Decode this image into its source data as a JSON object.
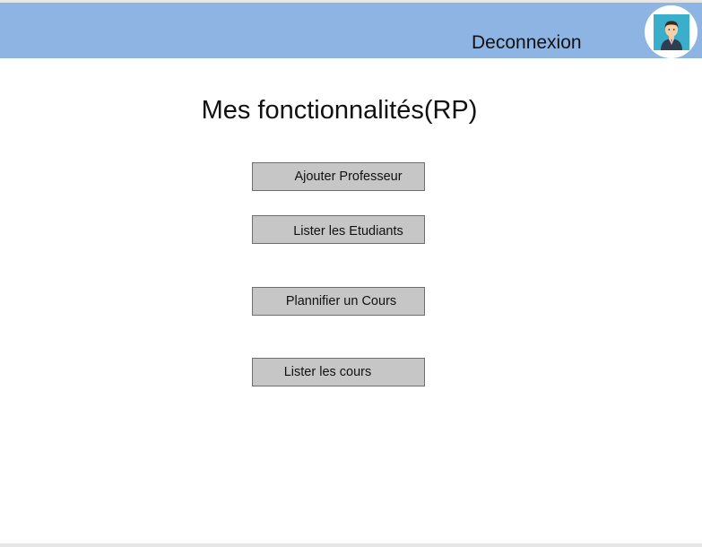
{
  "header": {
    "logout_label": "Deconnexion",
    "avatar_icon": "user-avatar-icon",
    "background_color": "#8db4e2"
  },
  "main": {
    "title": "Mes fonctionnalités(RP)",
    "buttons": [
      {
        "label": "Ajouter Professeur"
      },
      {
        "label": "Lister les Etudiants"
      },
      {
        "label": "Plannifier un Cours"
      },
      {
        "label": "Lister les cours"
      }
    ]
  }
}
